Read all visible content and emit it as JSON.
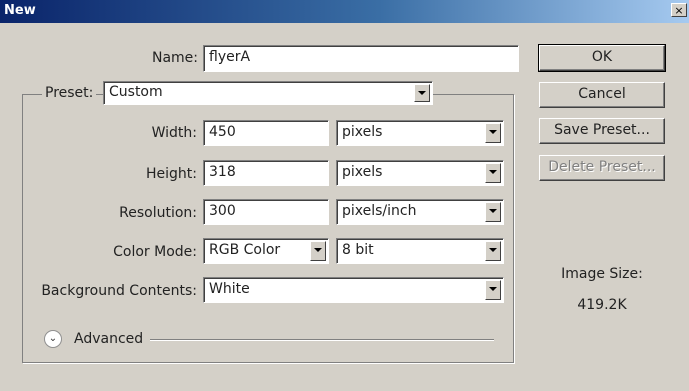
{
  "window": {
    "title": "New",
    "close_glyph": "×"
  },
  "form": {
    "name_label": "Name:",
    "name_value": "flyerA",
    "preset_label": "Preset:",
    "preset_value": "Custom",
    "width_label": "Width:",
    "width_value": "450",
    "width_unit": "pixels",
    "height_label": "Height:",
    "height_value": "318",
    "height_unit": "pixels",
    "resolution_label": "Resolution:",
    "resolution_value": "300",
    "resolution_unit": "pixels/inch",
    "color_mode_label": "Color Mode:",
    "color_mode_value": "RGB Color",
    "bit_depth_value": "8 bit",
    "background_label": "Background Contents:",
    "background_value": "White",
    "advanced_label": "Advanced",
    "advanced_icon": "chevron-down-circle-icon"
  },
  "buttons": {
    "ok": "OK",
    "cancel": "Cancel",
    "save_preset": "Save Preset...",
    "delete_preset": "Delete Preset..."
  },
  "image_size": {
    "label": "Image Size:",
    "value": "419.2K"
  }
}
